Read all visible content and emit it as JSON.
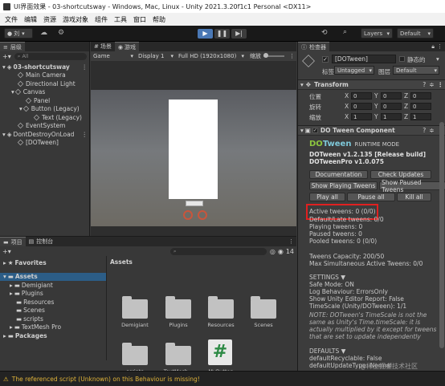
{
  "window": {
    "title": "UI界面效果 - 03-shortcutsway - Windows, Mac, Linux - Unity 2021.3.20f1c1 Personal <DX11>"
  },
  "menu": [
    "文件",
    "编辑",
    "资源",
    "游戏对象",
    "组件",
    "工具",
    "窗口",
    "帮助"
  ],
  "toolbar": {
    "account": "刘",
    "layers": "Layers",
    "layout": "Default"
  },
  "hierarchy": {
    "tab": "层级",
    "search_placeholder": "All",
    "items": [
      {
        "label": "03-shortcutsway",
        "depth": 0
      },
      {
        "label": "Main Camera",
        "depth": 2
      },
      {
        "label": "Directional Light",
        "depth": 2
      },
      {
        "label": "Canvas",
        "depth": 2
      },
      {
        "label": "Panel",
        "depth": 3
      },
      {
        "label": "Button (Legacy)",
        "depth": 3
      },
      {
        "label": "Text (Legacy)",
        "depth": 4
      },
      {
        "label": "EventSystem",
        "depth": 2
      },
      {
        "label": "DontDestroyOnLoad",
        "depth": 0
      },
      {
        "label": "[DOTween]",
        "depth": 2
      }
    ]
  },
  "scene_tabs": {
    "scene": "场景",
    "game": "游戏"
  },
  "game_bar": {
    "mode": "Game",
    "display": "Display 1",
    "resolution": "Full HD (1920x1080)",
    "scale_label": "缩放"
  },
  "project": {
    "tabs": [
      "项目",
      "控制台"
    ],
    "count": "14",
    "favorites": "Favorites",
    "tree": [
      "Assets",
      "Demigiant",
      "Plugins",
      "Resources",
      "Scenes",
      "scripts",
      "TextMesh Pro",
      "Packages"
    ],
    "breadcrumb": "Assets",
    "assets": [
      "Demigiant",
      "Plugins",
      "Resources",
      "Scenes",
      "scripts",
      "TextMesh...",
      "MyButton"
    ]
  },
  "status": {
    "message": "The referenced script (Unknown) on this Behaviour is missing!"
  },
  "inspector": {
    "tab": "检查器",
    "object_name": "[DOTween]",
    "static_label": "静态的",
    "tag_label": "标签",
    "tag": "Untagged",
    "layer_label": "图层",
    "layer": "Default",
    "transform": {
      "title": "Transform",
      "rows": [
        {
          "label": "位置",
          "x": "0",
          "y": "0",
          "z": "0"
        },
        {
          "label": "旋转",
          "x": "0",
          "y": "0",
          "z": "0"
        },
        {
          "label": "缩放",
          "x": "1",
          "y": "1",
          "z": "1"
        }
      ]
    },
    "component": {
      "title": "DO Tween Component",
      "logo_do": "DO",
      "logo_tween": "Tween",
      "runtime": "RUNTIME MODE",
      "version": "DOTween v1.2.135 [Release build]",
      "pro_version": "DOTweenPro v1.0.075",
      "buttons": [
        "Documentation",
        "Check Updates",
        "Show Playing Tweens",
        "Show Paused Tweens",
        "Play all",
        "Pause all",
        "Kill all"
      ],
      "stats": [
        "Active tweens: 0 (0/0)",
        "Default/Late tweens: 0/0",
        "Playing tweens: 0",
        "Paused tweens: 0",
        "Pooled tweens: 0 (0/0)"
      ],
      "capacity": [
        "Tweens Capacity: 200/50",
        "Max Simultaneous Active Tweens: 0/0"
      ],
      "settings_title": "SETTINGS ▼",
      "settings": [
        "Safe Mode: ON",
        "Log Behaviour: ErrorsOnly",
        "Show Unity Editor Report: False",
        "TimeScale (Unity/DOTween): 1/1"
      ],
      "note": [
        "NOTE: DOTween's TimeScale is not the",
        "same as Unity's Time.timeScale: it is",
        "actually multiplied by it except for tweens",
        "that are set to update independently"
      ],
      "defaults_title": "DEFAULTS ▼",
      "defaults": [
        "defaultRecyclable: False",
        "defaultUpdateType: Normal"
      ]
    }
  },
  "watermark": "@稀土掘金技术社区",
  "colors": {
    "highlight": "#e02020",
    "accent_button": "#4a7fb8",
    "logo_green": "#8dc63f"
  }
}
